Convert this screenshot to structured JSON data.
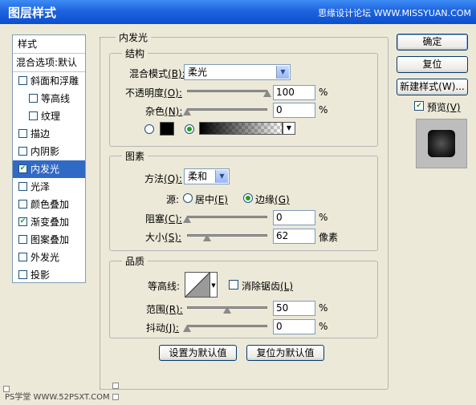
{
  "window": {
    "title": "图层样式",
    "watermark": "思缘设计论坛  WWW.MISSYUAN.COM"
  },
  "sidebar": {
    "header": "样式",
    "blend": "混合选项:默认",
    "items": [
      {
        "label": "斜面和浮雕",
        "checked": false
      },
      {
        "label": "等高线",
        "checked": false,
        "indent": true
      },
      {
        "label": "纹理",
        "checked": false,
        "indent": true
      },
      {
        "label": "描边",
        "checked": false
      },
      {
        "label": "内阴影",
        "checked": false
      },
      {
        "label": "内发光",
        "checked": true,
        "selected": true
      },
      {
        "label": "光泽",
        "checked": false
      },
      {
        "label": "颜色叠加",
        "checked": false
      },
      {
        "label": "渐变叠加",
        "checked": true
      },
      {
        "label": "图案叠加",
        "checked": false
      },
      {
        "label": "外发光",
        "checked": false
      },
      {
        "label": "投影",
        "checked": false
      }
    ]
  },
  "inner_glow": {
    "title": "内发光",
    "structure": {
      "title": "结构",
      "blend_mode_label": "混合模式",
      "blend_mode_key": "(B):",
      "blend_mode_value": "柔光",
      "opacity_label": "不透明度",
      "opacity_key": "(O):",
      "opacity_value": "100",
      "opacity_unit": "%",
      "opacity_level": 1.0,
      "noise_label": "杂色",
      "noise_key": "(N):",
      "noise_value": "0",
      "noise_unit": "%",
      "noise_level": 0.0,
      "color_mode": "gradient"
    },
    "elements": {
      "title": "图素",
      "method_label": "方法",
      "method_key": "(Q):",
      "method_value": "柔和",
      "source_label": "源:",
      "source_center": "居中",
      "source_center_key": "(E)",
      "source_edge": "边缘",
      "source_edge_key": "(G)",
      "source_selected": "edge",
      "choke_label": "阻塞",
      "choke_key": "(C):",
      "choke_value": "0",
      "choke_unit": "%",
      "choke_level": 0.0,
      "size_label": "大小",
      "size_key": "(S):",
      "size_value": "62",
      "size_unit": "像素",
      "size_level": 0.25
    },
    "quality": {
      "title": "品质",
      "contour_label": "等高线:",
      "antialias_label": "消除锯齿",
      "antialias_key": "(L)",
      "antialias_checked": false,
      "range_label": "范围",
      "range_key": "(R):",
      "range_value": "50",
      "range_unit": "%",
      "range_level": 0.5,
      "jitter_label": "抖动",
      "jitter_key": "(J):",
      "jitter_value": "0",
      "jitter_unit": "%",
      "jitter_level": 0.0
    },
    "set_default": "设置为默认值",
    "reset_default": "复位为默认值"
  },
  "buttons": {
    "ok": "确定",
    "reset": "复位",
    "new_style": "新建样式(W)...",
    "preview_label": "预览",
    "preview_key": "(V)",
    "preview_checked": true
  },
  "footer": "PS学堂  WWW.52PSXT.COM"
}
